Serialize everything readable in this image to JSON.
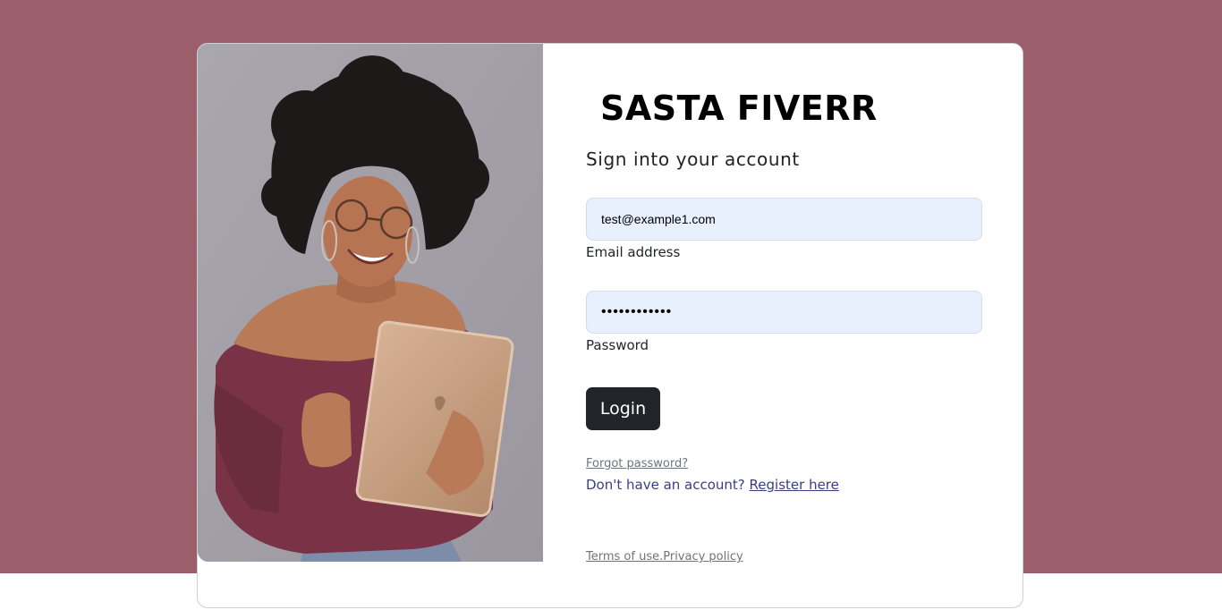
{
  "brand": {
    "name": "SASTA FIVERR"
  },
  "login_form": {
    "subtitle": "Sign into your account",
    "email": {
      "value": "test@example1.com",
      "label": "Email address"
    },
    "password": {
      "value": "••••••••••••",
      "label": "Password"
    },
    "submit_label": "Login",
    "forgot_password": "Forgot password?",
    "register_prompt": "Don't have an account?",
    "register_link": "Register here"
  },
  "footer": {
    "terms": "Terms of use.",
    "privacy": "Privacy policy"
  },
  "colors": {
    "page_background": "#9a5f6b",
    "card_background": "#ffffff",
    "input_background": "#e8f0fe",
    "button_background": "#212529",
    "link_color": "#393f81",
    "muted_text": "#6c757d"
  },
  "hero_image": {
    "subject": "woman with curly hair and glasses holding a tablet"
  }
}
